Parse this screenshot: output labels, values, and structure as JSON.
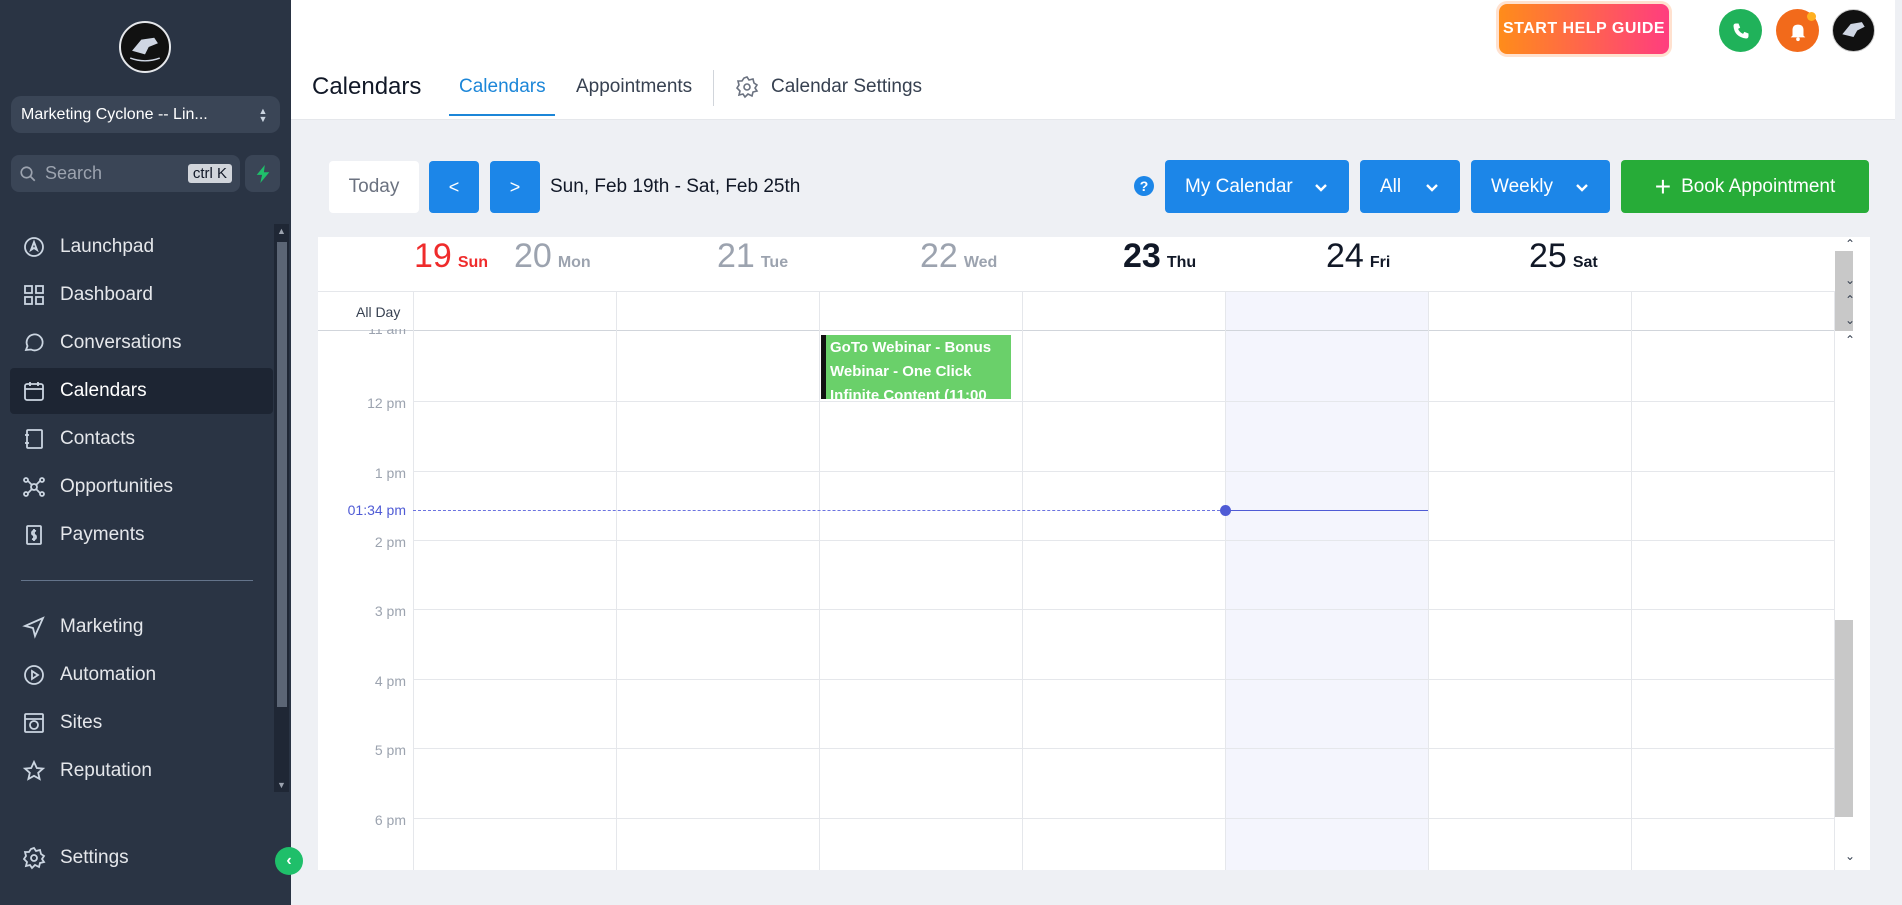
{
  "sidebar": {
    "account_name": "Marketing Cyclone -- Lin...",
    "search_placeholder": "Search",
    "search_shortcut": "ctrl K",
    "items": [
      {
        "label": "Launchpad",
        "icon": "rocket-icon"
      },
      {
        "label": "Dashboard",
        "icon": "grid-icon"
      },
      {
        "label": "Conversations",
        "icon": "chat-icon"
      },
      {
        "label": "Calendars",
        "icon": "calendar-icon",
        "active": true
      },
      {
        "label": "Contacts",
        "icon": "contact-book-icon"
      },
      {
        "label": "Opportunities",
        "icon": "network-icon"
      },
      {
        "label": "Payments",
        "icon": "receipt-icon"
      }
    ],
    "items2": [
      {
        "label": "Marketing",
        "icon": "send-icon"
      },
      {
        "label": "Automation",
        "icon": "play-circle-icon"
      },
      {
        "label": "Sites",
        "icon": "globe-window-icon"
      },
      {
        "label": "Reputation",
        "icon": "star-icon"
      }
    ],
    "settings_label": "Settings"
  },
  "header": {
    "help_label": "START HELP GUIDE",
    "page_title": "Calendars",
    "tabs": [
      "Calendars",
      "Appointments"
    ],
    "settings_tab": "Calendar Settings"
  },
  "toolbar": {
    "today": "Today",
    "prev": "<",
    "next": ">",
    "range": "Sun, Feb 19th - Sat, Feb 25th",
    "help": "?",
    "calendar_select": "My Calendar",
    "filter_select": "All",
    "view_select": "Weekly",
    "book": "Book Appointment"
  },
  "calendar": {
    "days": [
      {
        "num": "19",
        "name": "Sun"
      },
      {
        "num": "20",
        "name": "Mon"
      },
      {
        "num": "21",
        "name": "Tue"
      },
      {
        "num": "22",
        "name": "Wed"
      },
      {
        "num": "23",
        "name": "Thu"
      },
      {
        "num": "24",
        "name": "Fri"
      },
      {
        "num": "25",
        "name": "Sat"
      }
    ],
    "all_day": "All Day",
    "partial_time": "11 am",
    "times": [
      "12 pm",
      "1 pm",
      "2 pm",
      "3 pm",
      "4 pm",
      "5 pm",
      "6 pm"
    ],
    "now_label": "01:34 pm",
    "event_title": "GoTo Webinar - Bonus Webinar - One Click Infinite Content (11:00"
  },
  "colors": {
    "accent": "#1c86e8",
    "book": "#27ac38",
    "sidebar": "#2a3444",
    "event": "#6ad06a",
    "now": "#4f5bd5"
  }
}
